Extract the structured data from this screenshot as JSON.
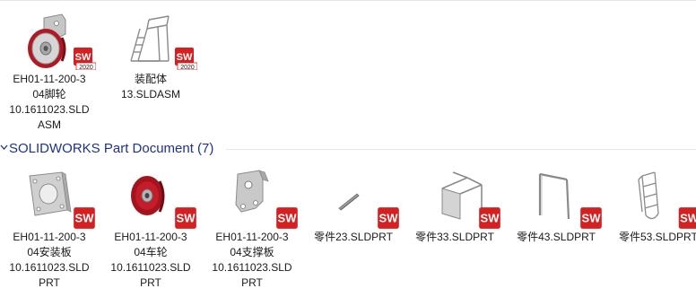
{
  "icons": {
    "badge": "solidworks-icon",
    "badge_year": "2020",
    "chevron": "chevron-down-icon"
  },
  "colors": {
    "group_title": "#1e3287",
    "badge_red": "#d42020"
  },
  "assemblies": [
    {
      "name_lines": [
        "EH01-11-200-3",
        "04脚轮",
        "10.1611023.SLD",
        "ASM"
      ],
      "icon": "caster-wheel-thumbnail"
    },
    {
      "name_lines": [
        "装配体",
        "13.SLDASM"
      ],
      "icon": "platform-ladder-thumbnail"
    }
  ],
  "group": {
    "title": "SOLIDWORKS Part Document (7)"
  },
  "parts": [
    {
      "name_lines": [
        "EH01-11-200-3",
        "04安装板",
        "10.1611023.SLD",
        "PRT"
      ],
      "icon": "mounting-plate-thumbnail"
    },
    {
      "name_lines": [
        "EH01-11-200-3",
        "04车轮",
        "10.1611023.SLD",
        "PRT"
      ],
      "icon": "wheel-thumbnail"
    },
    {
      "name_lines": [
        "EH01-11-200-3",
        "04支撑板",
        "10.1611023.SLD",
        "PRT"
      ],
      "icon": "support-plate-thumbnail"
    },
    {
      "name_lines": [
        "零件23.SLDPRT"
      ],
      "icon": "bar-part-thumbnail"
    },
    {
      "name_lines": [
        "零件33.SLDPRT"
      ],
      "icon": "frame-part-thumbnail"
    },
    {
      "name_lines": [
        "零件43.SLDPRT"
      ],
      "icon": "arch-part-thumbnail"
    },
    {
      "name_lines": [
        "零件53.SLDPRT"
      ],
      "icon": "rail-part-thumbnail"
    }
  ]
}
